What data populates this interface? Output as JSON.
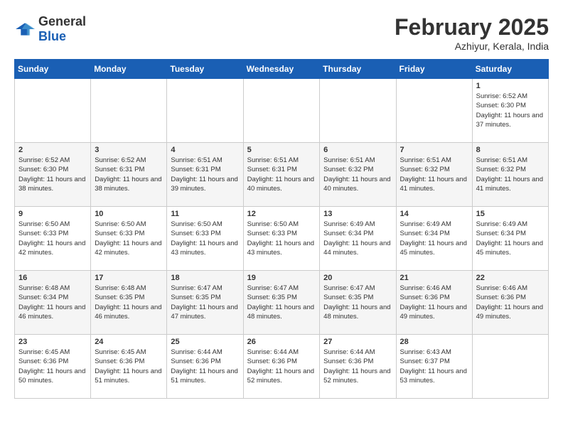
{
  "header": {
    "logo_general": "General",
    "logo_blue": "Blue",
    "month_title": "February 2025",
    "location": "Azhiyur, Kerala, India"
  },
  "days_of_week": [
    "Sunday",
    "Monday",
    "Tuesday",
    "Wednesday",
    "Thursday",
    "Friday",
    "Saturday"
  ],
  "weeks": [
    [
      {
        "day": "",
        "content": ""
      },
      {
        "day": "",
        "content": ""
      },
      {
        "day": "",
        "content": ""
      },
      {
        "day": "",
        "content": ""
      },
      {
        "day": "",
        "content": ""
      },
      {
        "day": "",
        "content": ""
      },
      {
        "day": "1",
        "content": "Sunrise: 6:52 AM\nSunset: 6:30 PM\nDaylight: 11 hours and 37 minutes."
      }
    ],
    [
      {
        "day": "2",
        "content": "Sunrise: 6:52 AM\nSunset: 6:30 PM\nDaylight: 11 hours and 38 minutes."
      },
      {
        "day": "3",
        "content": "Sunrise: 6:52 AM\nSunset: 6:31 PM\nDaylight: 11 hours and 38 minutes."
      },
      {
        "day": "4",
        "content": "Sunrise: 6:51 AM\nSunset: 6:31 PM\nDaylight: 11 hours and 39 minutes."
      },
      {
        "day": "5",
        "content": "Sunrise: 6:51 AM\nSunset: 6:31 PM\nDaylight: 11 hours and 40 minutes."
      },
      {
        "day": "6",
        "content": "Sunrise: 6:51 AM\nSunset: 6:32 PM\nDaylight: 11 hours and 40 minutes."
      },
      {
        "day": "7",
        "content": "Sunrise: 6:51 AM\nSunset: 6:32 PM\nDaylight: 11 hours and 41 minutes."
      },
      {
        "day": "8",
        "content": "Sunrise: 6:51 AM\nSunset: 6:32 PM\nDaylight: 11 hours and 41 minutes."
      }
    ],
    [
      {
        "day": "9",
        "content": "Sunrise: 6:50 AM\nSunset: 6:33 PM\nDaylight: 11 hours and 42 minutes."
      },
      {
        "day": "10",
        "content": "Sunrise: 6:50 AM\nSunset: 6:33 PM\nDaylight: 11 hours and 42 minutes."
      },
      {
        "day": "11",
        "content": "Sunrise: 6:50 AM\nSunset: 6:33 PM\nDaylight: 11 hours and 43 minutes."
      },
      {
        "day": "12",
        "content": "Sunrise: 6:50 AM\nSunset: 6:33 PM\nDaylight: 11 hours and 43 minutes."
      },
      {
        "day": "13",
        "content": "Sunrise: 6:49 AM\nSunset: 6:34 PM\nDaylight: 11 hours and 44 minutes."
      },
      {
        "day": "14",
        "content": "Sunrise: 6:49 AM\nSunset: 6:34 PM\nDaylight: 11 hours and 45 minutes."
      },
      {
        "day": "15",
        "content": "Sunrise: 6:49 AM\nSunset: 6:34 PM\nDaylight: 11 hours and 45 minutes."
      }
    ],
    [
      {
        "day": "16",
        "content": "Sunrise: 6:48 AM\nSunset: 6:34 PM\nDaylight: 11 hours and 46 minutes."
      },
      {
        "day": "17",
        "content": "Sunrise: 6:48 AM\nSunset: 6:35 PM\nDaylight: 11 hours and 46 minutes."
      },
      {
        "day": "18",
        "content": "Sunrise: 6:47 AM\nSunset: 6:35 PM\nDaylight: 11 hours and 47 minutes."
      },
      {
        "day": "19",
        "content": "Sunrise: 6:47 AM\nSunset: 6:35 PM\nDaylight: 11 hours and 48 minutes."
      },
      {
        "day": "20",
        "content": "Sunrise: 6:47 AM\nSunset: 6:35 PM\nDaylight: 11 hours and 48 minutes."
      },
      {
        "day": "21",
        "content": "Sunrise: 6:46 AM\nSunset: 6:36 PM\nDaylight: 11 hours and 49 minutes."
      },
      {
        "day": "22",
        "content": "Sunrise: 6:46 AM\nSunset: 6:36 PM\nDaylight: 11 hours and 49 minutes."
      }
    ],
    [
      {
        "day": "23",
        "content": "Sunrise: 6:45 AM\nSunset: 6:36 PM\nDaylight: 11 hours and 50 minutes."
      },
      {
        "day": "24",
        "content": "Sunrise: 6:45 AM\nSunset: 6:36 PM\nDaylight: 11 hours and 51 minutes."
      },
      {
        "day": "25",
        "content": "Sunrise: 6:44 AM\nSunset: 6:36 PM\nDaylight: 11 hours and 51 minutes."
      },
      {
        "day": "26",
        "content": "Sunrise: 6:44 AM\nSunset: 6:36 PM\nDaylight: 11 hours and 52 minutes."
      },
      {
        "day": "27",
        "content": "Sunrise: 6:44 AM\nSunset: 6:36 PM\nDaylight: 11 hours and 52 minutes."
      },
      {
        "day": "28",
        "content": "Sunrise: 6:43 AM\nSunset: 6:37 PM\nDaylight: 11 hours and 53 minutes."
      },
      {
        "day": "",
        "content": ""
      }
    ]
  ]
}
